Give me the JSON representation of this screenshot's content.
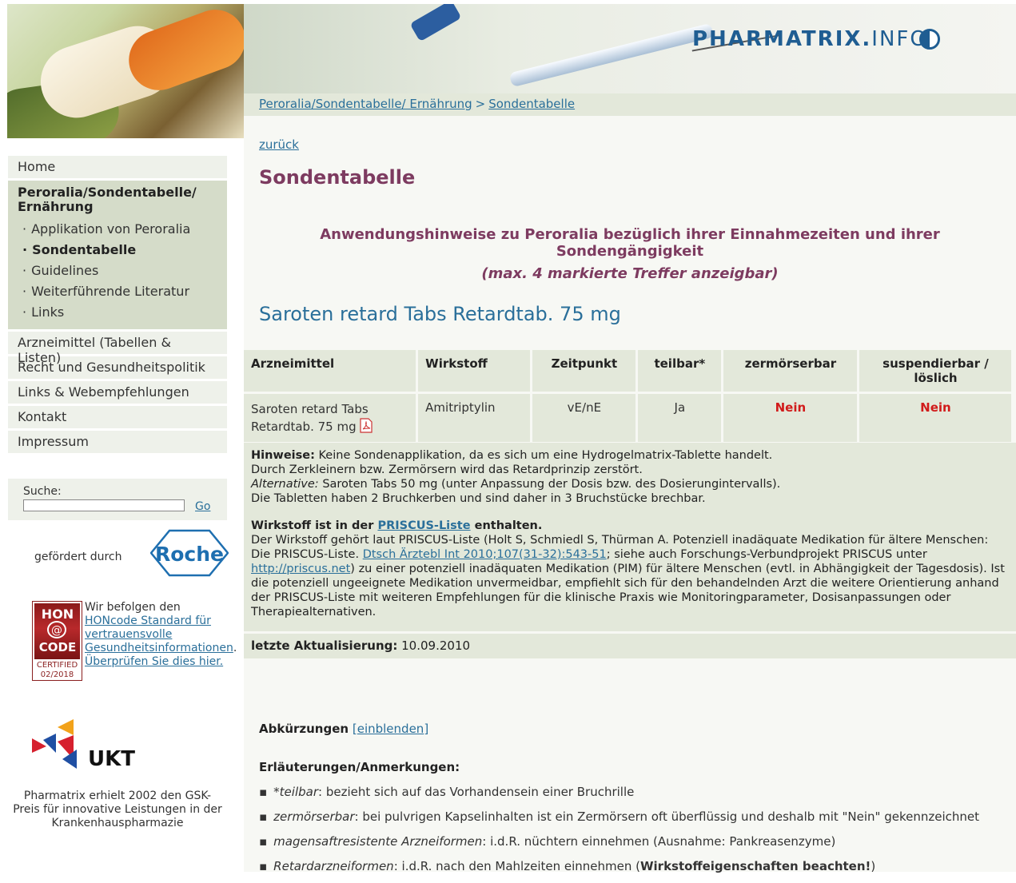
{
  "header": {
    "brand_bold": "PHARMATRIX.",
    "brand_light": "INFO",
    "breadcrumb": [
      {
        "label": "Peroralia/Sondentabelle/ Ernährung"
      },
      {
        "label": "Sondentabelle"
      }
    ],
    "breadcrumb_separator": ">"
  },
  "sidebar": {
    "nav": {
      "home": "Home",
      "group_title": "Peroralia/Sondentabelle/ Ernährung",
      "sub_items": [
        {
          "label": "Applikation von Peroralia",
          "active": false
        },
        {
          "label": "Sondentabelle",
          "active": true
        },
        {
          "label": "Guidelines",
          "active": false
        },
        {
          "label": "Weiterführende Literatur",
          "active": false
        },
        {
          "label": "Links",
          "active": false
        }
      ],
      "items_after": [
        "Arzneimittel (Tabellen & Listen)",
        "Recht und Gesundheitspolitik",
        "Links & Webempfehlungen",
        "Kontakt",
        "Impressum"
      ]
    },
    "search": {
      "label": "Suche:",
      "value": "",
      "go": "Go"
    },
    "sponsor": {
      "label": "gefördert durch",
      "logo": "Roche"
    },
    "hon": {
      "badge_top": "HON",
      "badge_bottom": "CODE",
      "badge_cert": "CERTIFIED",
      "badge_date": "02/2018",
      "text": "Wir befolgen den",
      "link1": "HONcode Standard für vertrauensvolle Gesundheitsinformationen",
      "link1_suffix": ".",
      "link2": "Überprüfen Sie dies hier."
    },
    "ukt": {
      "logo": "UKT"
    },
    "caption": "Pharmatrix erhielt 2002 den GSK-Preis für innovative Leistungen in der Krankenhauspharmazie"
  },
  "content": {
    "back": "zurück",
    "title": "Sondentabelle",
    "subtitle": "Anwendungshinweise zu Peroralia bezüglich ihrer Einnahmezeiten und ihrer Sondengängigkeit",
    "hint": "(max. 4 markierte Treffer anzeigbar)",
    "drug_name": "Saroten retard Tabs Retardtab. 75 mg",
    "table": {
      "headers": [
        "Arzneimittel",
        "Wirkstoff",
        "Zeitpunkt",
        "teilbar*",
        "zermörserbar",
        "suspendierbar / löslich"
      ],
      "row": {
        "arzneimittel": "Saroten retard Tabs Retardtab. 75 mg",
        "wirkstoff": "Amitriptylin",
        "zeitpunkt": "vE/nE",
        "teilbar": "Ja",
        "zermoerserbar": "Nein",
        "suspendierbar": "Nein"
      }
    },
    "notes": {
      "hinweise_label": "Hinweise:",
      "hinweise_text": "Keine Sondenapplikation, da es sich um eine Hydrogelmatrix-Tablette handelt.",
      "line2": "Durch Zerkleinern bzw. Zermörsern wird das Retardprinzip zerstört.",
      "alternative_label": "Alternative:",
      "alternative_text": "Saroten Tabs 50 mg (unter Anpassung der Dosis bzw. des Dosierungintervalls).",
      "line4": "Die Tabletten haben 2 Bruchkerben und sind daher in 3 Bruchstücke brechbar.",
      "priscus_pre": "Wirkstoff ist in der",
      "priscus_link": "PRISCUS-Liste",
      "priscus_post": "enthalten.",
      "priscus_text1": "Der Wirkstoff gehört laut PRISCUS-Liste (Holt S, Schmiedl S, Thürman A. Potenziell inadäquate Medikation für ältere Menschen: Die PRISCUS-Liste.",
      "priscus_ref_link": "Dtsch Ärztebl Int 2010;107(31-32):543-51",
      "priscus_text2": "; siehe auch Forschungs-Verbundprojekt PRISCUS unter",
      "priscus_url": "http://priscus.net",
      "priscus_text3": ") zu einer potenziell inadäquaten Medikation (PIM) für ältere Menschen (evtl. in Abhängigkeit der Tagesdosis). Ist die potenziell ungeeignete Medikation unvermeidbar, empfiehlt sich für den behandelnden Arzt die weitere Orientierung anhand der PRISCUS-Liste mit weiteren Empfehlungen für die klinische Praxis wie Monitoringparameter, Dosisanpassungen oder Therapiealternativen."
    },
    "update": {
      "label": "letzte Aktualisierung:",
      "date": "10.09.2010"
    },
    "abbr": {
      "label": "Abkürzungen",
      "link": "einblenden"
    },
    "explanations": {
      "title": "Erläuterungen/Anmerkungen:",
      "items": [
        {
          "term": "*teilbar",
          "text": ": bezieht sich auf das Vorhandensein einer Bruchrille",
          "strong": ""
        },
        {
          "term": "zermörserbar",
          "text": ": bei pulvrigen Kapselinhalten ist ein Zermörsern oft überflüssig und deshalb mit \"Nein\" gekennzeichnet",
          "strong": ""
        },
        {
          "term": "magensaftresistente Arzneiformen",
          "text": ": i.d.R. nüchtern einnehmen (Ausnahme: Pankreasenzyme)",
          "strong": ""
        },
        {
          "term": "Retardarzneiformen",
          "text": ": i.d.R. nach den Mahlzeiten einnehmen (",
          "strong": "Wirkstoffeigenschaften beachten!",
          "after": ")"
        }
      ]
    }
  },
  "colors": {
    "title": "#7d3b60",
    "link": "#2a6f9a",
    "panel": "#e3e8da",
    "negative": "#d11b1b"
  }
}
